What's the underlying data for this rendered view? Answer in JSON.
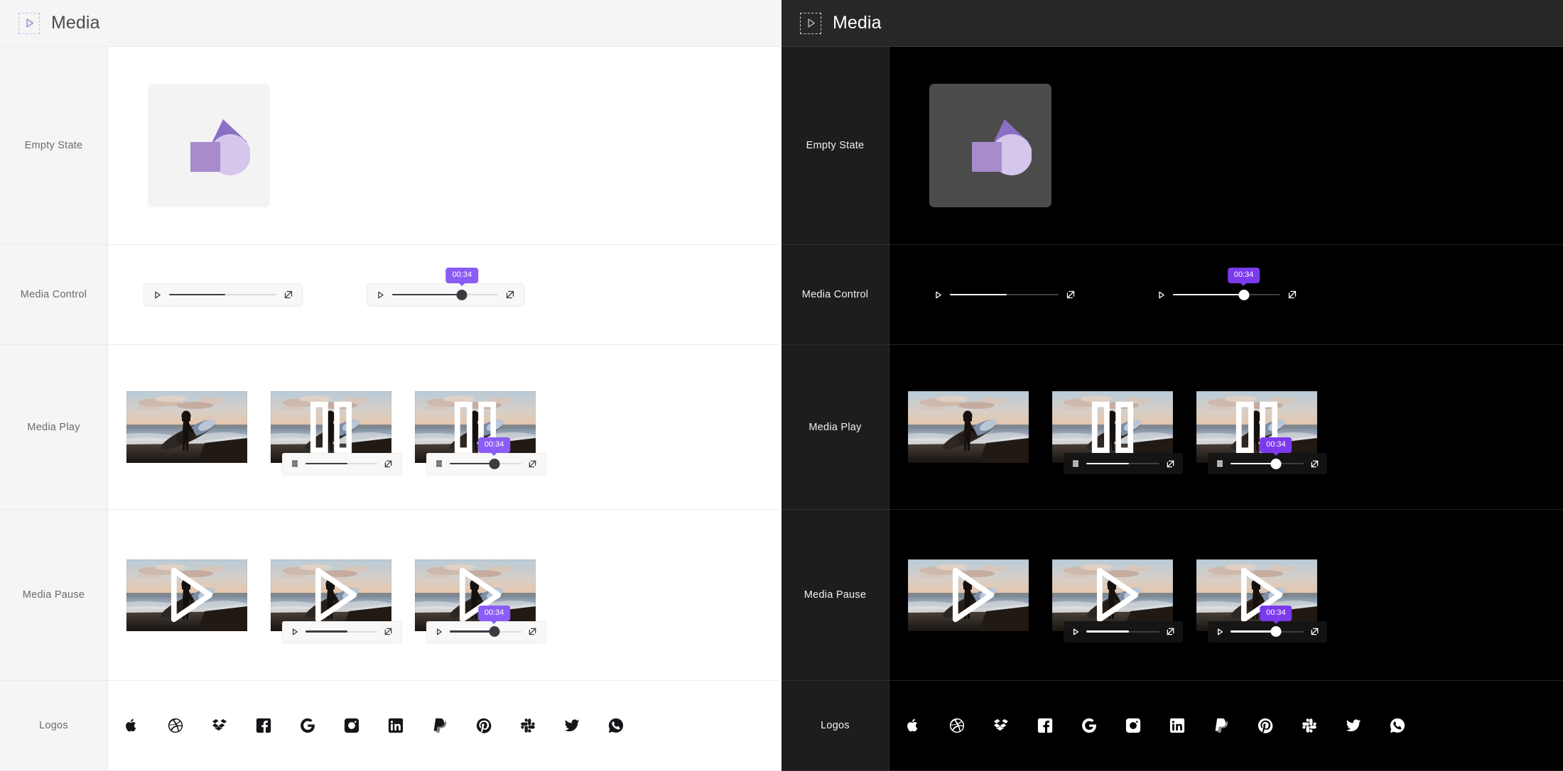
{
  "header": {
    "icon": "play-triangle-icon",
    "title": "Media"
  },
  "rows": [
    {
      "key": "empty",
      "label": "Empty State"
    },
    {
      "key": "control",
      "label": "Media Control"
    },
    {
      "key": "play",
      "label": "Media Play"
    },
    {
      "key": "pause",
      "label": "Media Pause"
    },
    {
      "key": "logos",
      "label": "Logos"
    }
  ],
  "empty_state": {
    "placeholder_icon": "image-placeholder-shapes-icon",
    "shapes": [
      "triangle",
      "square",
      "circle"
    ],
    "colors": {
      "triangle": "#8b6fc4",
      "square": "#a78bca",
      "circle": "#d5c6ec"
    },
    "box_color_light": "#f3f3f3",
    "box_color_dark": "#4b4b4b"
  },
  "media_control": {
    "bar_a": {
      "play_icon": "play-icon",
      "fullscreen_icon": "fullscreen-icon",
      "progress_percent": 52,
      "has_tooltip": false,
      "has_knob": false
    },
    "bar_b": {
      "play_icon": "play-icon",
      "fullscreen_icon": "fullscreen-icon",
      "progress_percent": 66,
      "has_tooltip": true,
      "has_knob": true,
      "tooltip_time": "00:34"
    }
  },
  "media_play": {
    "cards": [
      {
        "center_icon": "none",
        "has_control_bar": false,
        "bar_icon": "",
        "progress_percent": 0,
        "has_tooltip": false,
        "has_knob": false,
        "tooltip_time": ""
      },
      {
        "center_icon": "pause-icon",
        "has_control_bar": true,
        "bar_icon": "pause-icon",
        "progress_percent": 58,
        "has_tooltip": false,
        "has_knob": false,
        "tooltip_time": ""
      },
      {
        "center_icon": "pause-icon",
        "has_control_bar": true,
        "bar_icon": "pause-icon",
        "progress_percent": 62,
        "has_tooltip": true,
        "has_knob": true,
        "tooltip_time": "00:34"
      }
    ]
  },
  "media_pause": {
    "cards": [
      {
        "center_icon": "play-icon",
        "has_control_bar": false,
        "bar_icon": "",
        "progress_percent": 0,
        "has_tooltip": false,
        "has_knob": false,
        "tooltip_time": ""
      },
      {
        "center_icon": "play-icon",
        "has_control_bar": true,
        "bar_icon": "play-icon",
        "progress_percent": 58,
        "has_tooltip": false,
        "has_knob": false,
        "tooltip_time": ""
      },
      {
        "center_icon": "play-icon",
        "has_control_bar": true,
        "bar_icon": "play-icon",
        "progress_percent": 62,
        "has_tooltip": true,
        "has_knob": true,
        "tooltip_time": "00:34"
      }
    ]
  },
  "logos": {
    "items": [
      {
        "name": "apple-logo-icon",
        "label": "Apple"
      },
      {
        "name": "dribbble-logo-icon",
        "label": "Dribbble"
      },
      {
        "name": "dropbox-logo-icon",
        "label": "Dropbox"
      },
      {
        "name": "facebook-logo-icon",
        "label": "Facebook"
      },
      {
        "name": "google-logo-icon",
        "label": "Google"
      },
      {
        "name": "instagram-logo-icon",
        "label": "Instagram"
      },
      {
        "name": "linkedin-logo-icon",
        "label": "LinkedIn"
      },
      {
        "name": "paypal-logo-icon",
        "label": "PayPal"
      },
      {
        "name": "pinterest-logo-icon",
        "label": "Pinterest"
      },
      {
        "name": "slack-logo-icon",
        "label": "Slack"
      },
      {
        "name": "twitter-logo-icon",
        "label": "Twitter"
      },
      {
        "name": "whatsapp-logo-icon",
        "label": "WhatsApp"
      }
    ]
  },
  "theme": {
    "accent": "#8b5cf6",
    "accent_dark": "#7c3aed",
    "light_bg": "#ffffff",
    "light_rail_bg": "#f5f5f5",
    "dark_bg": "#000000",
    "dark_rail_bg": "#1d1d1d",
    "dark_header_bg": "#272727"
  },
  "thumbnail": {
    "description": "Surfer silhouette carrying surfboard on beach at sunset"
  }
}
